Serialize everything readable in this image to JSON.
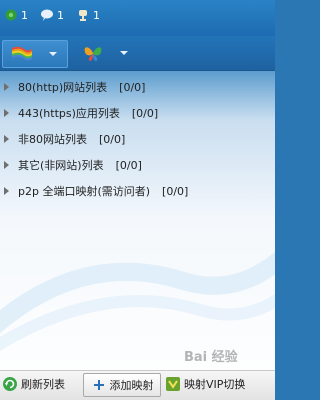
{
  "status": {
    "items": [
      {
        "icon": "leaf-icon",
        "count": "1"
      },
      {
        "icon": "chat-icon",
        "count": "1"
      },
      {
        "icon": "trophy-icon",
        "count": "1"
      }
    ]
  },
  "toolbar": {
    "buttons": [
      {
        "icon": "rainbow-flag-icon",
        "dropdown": "chevron-down-icon"
      },
      {
        "icon": "butterfly-icon",
        "dropdown": "chevron-down-icon"
      }
    ]
  },
  "list": {
    "items": [
      {
        "name": "80(http)网站列表",
        "count": "[0/0]"
      },
      {
        "name": "443(https)应用列表",
        "count": "[0/0]"
      },
      {
        "name": "非80网站列表",
        "count": "[0/0]"
      },
      {
        "name": "其它(非网站)列表",
        "count": "[0/0]"
      },
      {
        "name": "p2p 全端口映射(需访问者)",
        "count": "[0/0]"
      }
    ]
  },
  "bottom": {
    "refresh_label": "刷新列表",
    "add_label": "添加映射",
    "vip_label": "映射VIP切换"
  },
  "watermark": "Bai 经验",
  "colors": {
    "accent": "#1e6fb3",
    "list_text": "#222222"
  }
}
